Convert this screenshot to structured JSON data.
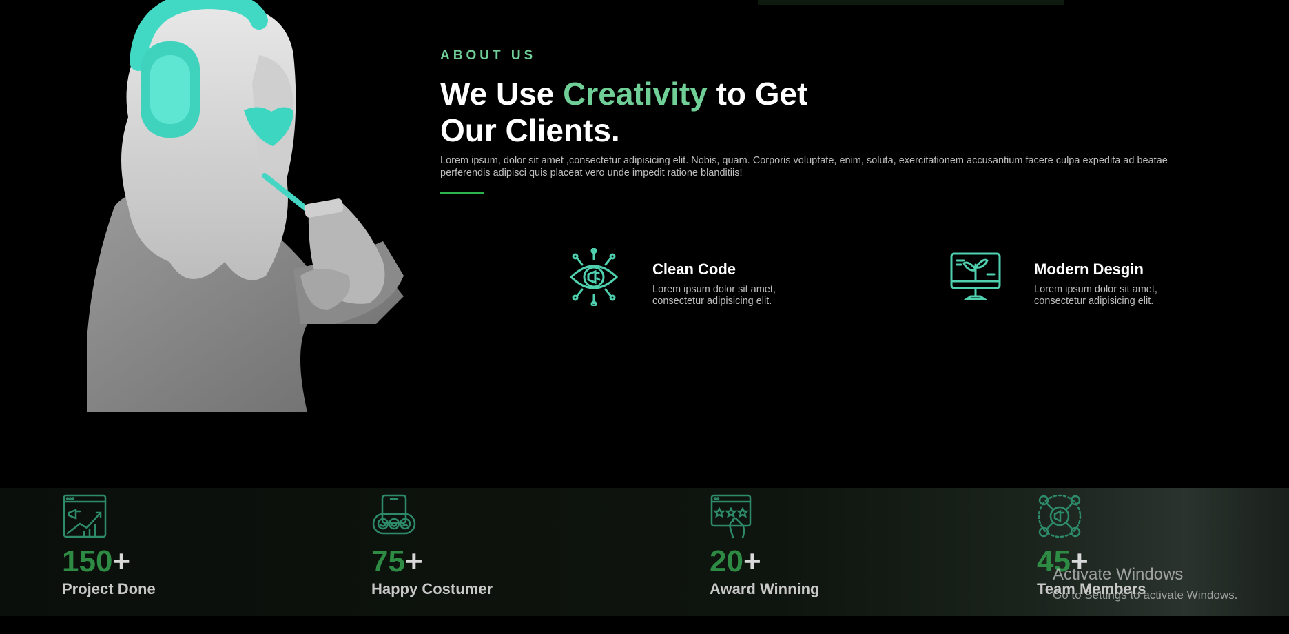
{
  "about": {
    "eyebrow": "ABOUT US",
    "headline_pre": "We Use",
    "headline_accent": "Creativity",
    "headline_post": "to Get Our Clients.",
    "intro": "Lorem ipsum, dolor sit amet ,consectetur adipisicing elit. Nobis, quam. Corporis voluptate, enim, soluta, exercitationem accusantium facere culpa expedita ad beatae perferendis adipisci quis placeat vero unde impedit ratione blanditiis!"
  },
  "features": [
    {
      "icon": "eye-megaphone-icon",
      "title": "Clean Code",
      "desc": "Lorem ipsum dolor sit amet, consectetur adipisicing elit."
    },
    {
      "icon": "monitor-plant-icon",
      "title": "Modern Desgin",
      "desc": "Lorem ipsum dolor sit amet, consectetur adipisicing elit."
    }
  ],
  "stats": [
    {
      "icon": "analytics-chart-icon",
      "number": "150",
      "suffix": "+",
      "label": "Project Done"
    },
    {
      "icon": "feedback-faces-icon",
      "number": "75",
      "suffix": "+",
      "label": "Happy Costumer"
    },
    {
      "icon": "rating-stars-icon",
      "number": "20",
      "suffix": "+",
      "label": "Award Winning"
    },
    {
      "icon": "network-megaphone-icon",
      "number": "45",
      "suffix": "+",
      "label": "Team Members"
    }
  ],
  "watermark": {
    "line1": "Activate Windows",
    "line2": "Go to Settings to activate Windows."
  },
  "colors": {
    "accent": "#6fcf97",
    "number_green": "#2e8b44",
    "icon_teal": "#4fd1b0",
    "background": "#000000"
  }
}
